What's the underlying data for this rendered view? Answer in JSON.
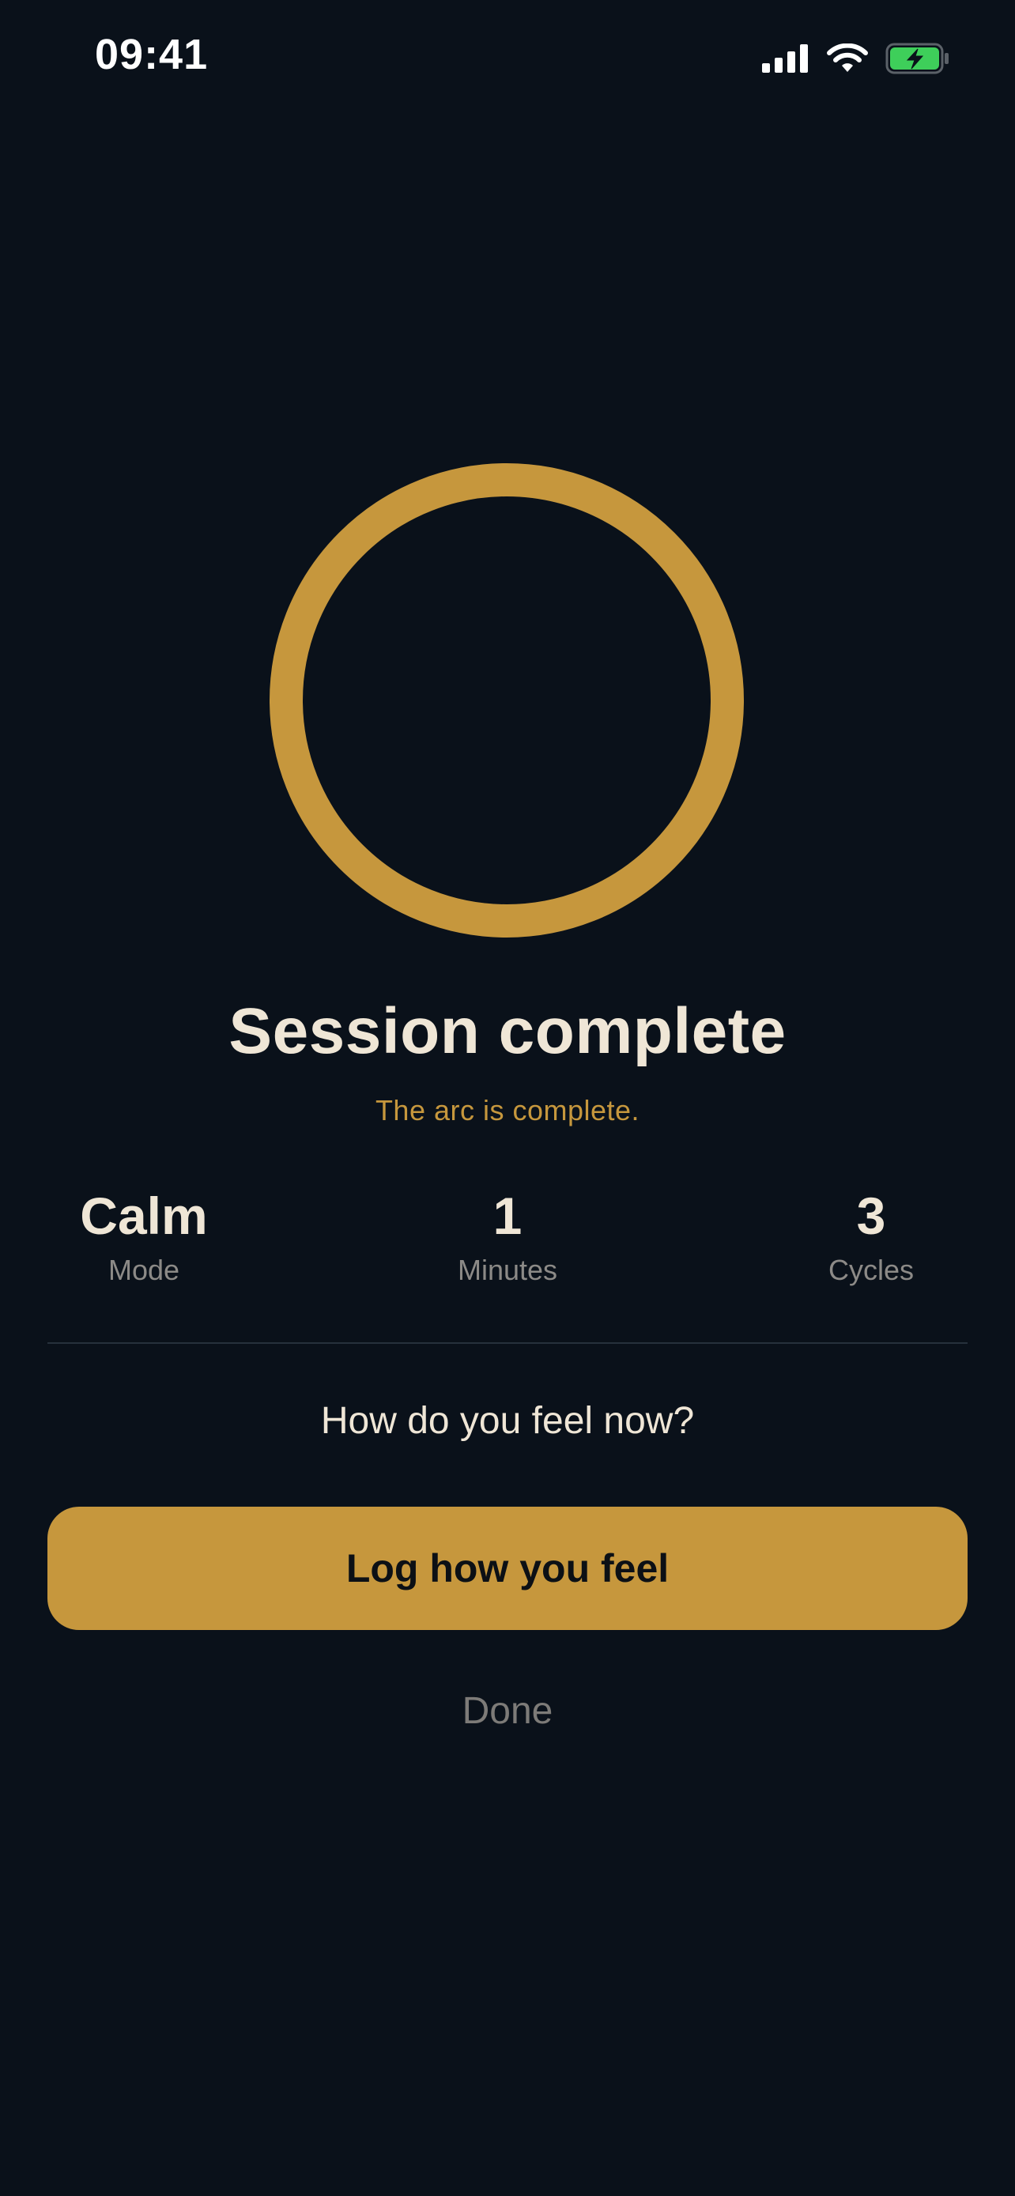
{
  "status_bar": {
    "time": "09:41",
    "icons": [
      "cellular-signal-icon",
      "wifi-icon",
      "battery-charging-icon"
    ]
  },
  "progress_ring": {
    "progress": 1.0,
    "color": "#c6973d"
  },
  "session": {
    "title": "Session complete",
    "subtitle": "The arc is complete."
  },
  "stats": [
    {
      "value": "Calm",
      "label": "Mode"
    },
    {
      "value": "1",
      "label": "Minutes"
    },
    {
      "value": "3",
      "label": "Cycles"
    }
  ],
  "prompt": {
    "question": "How do you feel now?"
  },
  "actions": {
    "primary_label": "Log how you feel",
    "secondary_label": "Done"
  },
  "colors": {
    "background": "#0a111a",
    "accent": "#c6973d",
    "text": "#efe6d6",
    "muted": "#8c8a87",
    "battery": "#3ecf5a"
  }
}
